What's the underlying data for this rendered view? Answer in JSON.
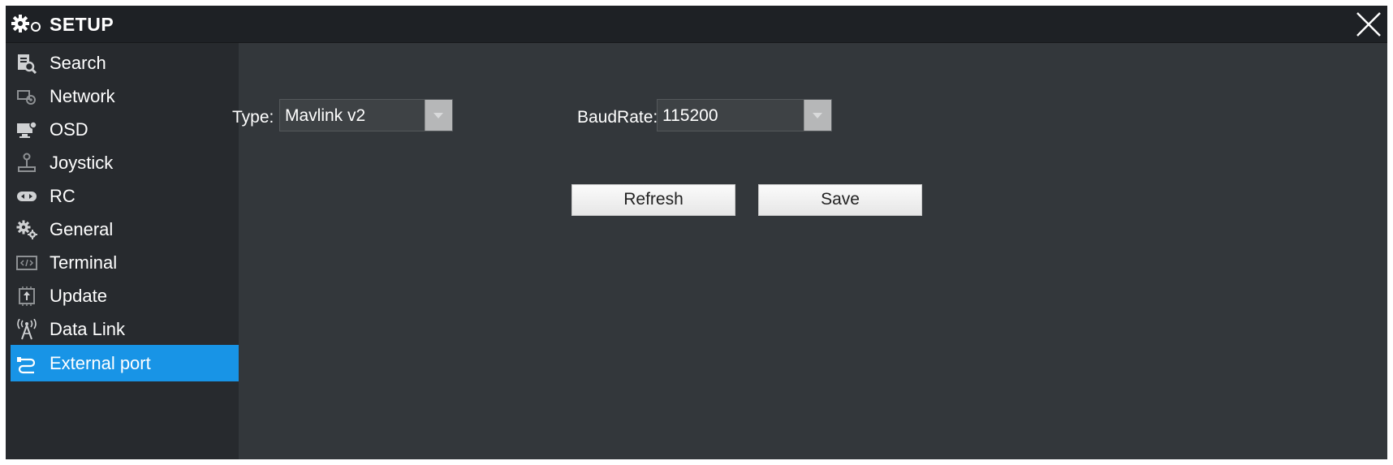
{
  "window": {
    "title": "SETUP",
    "app_icon": "gears-icon",
    "close_icon": "close-icon"
  },
  "sidebar": {
    "active_index": 9,
    "accent_color": "#1894e6",
    "items": [
      {
        "label": "Search",
        "icon": "search-document-icon"
      },
      {
        "label": "Network",
        "icon": "network-icon"
      },
      {
        "label": "OSD",
        "icon": "osd-monitor-icon"
      },
      {
        "label": "Joystick",
        "icon": "joystick-icon"
      },
      {
        "label": "RC",
        "icon": "rc-icon"
      },
      {
        "label": "General",
        "icon": "gears-icon"
      },
      {
        "label": "Terminal",
        "icon": "terminal-icon"
      },
      {
        "label": "Update",
        "icon": "update-chip-icon"
      },
      {
        "label": "Data Link",
        "icon": "antenna-icon"
      },
      {
        "label": "External port",
        "icon": "cable-icon"
      }
    ]
  },
  "main": {
    "type_field": {
      "label": "Type:",
      "value": "Mavlink v2"
    },
    "baudrate_field": {
      "label": "BaudRate:",
      "value": "115200"
    },
    "refresh_label": "Refresh",
    "save_label": "Save"
  }
}
